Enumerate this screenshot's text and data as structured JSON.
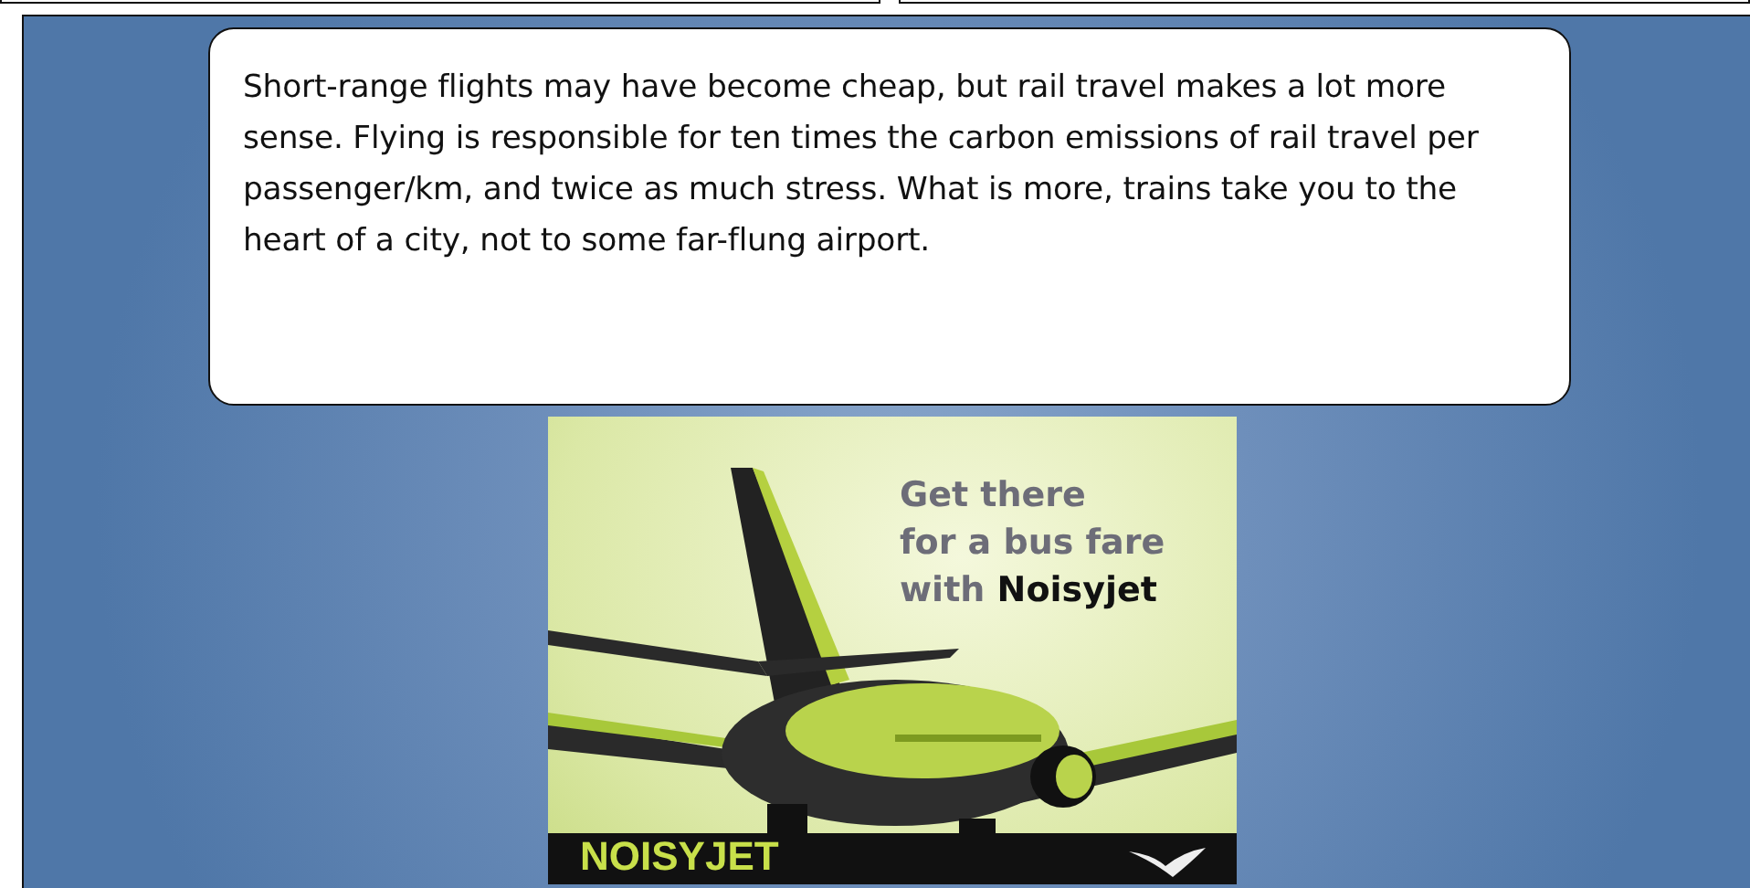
{
  "caption": "Short-range flights may have become cheap, but rail travel makes a lot more sense. Flying is responsible for ten times the carbon emissions of rail travel per passenger/km, and twice as much stress. What is more, trains take you to the heart of a city, not to some far-flung airport.",
  "advert": {
    "headline_lines": [
      "Get there",
      "for a bus fare",
      "with **Noisyjet**"
    ],
    "logo": "NOISYJET"
  }
}
